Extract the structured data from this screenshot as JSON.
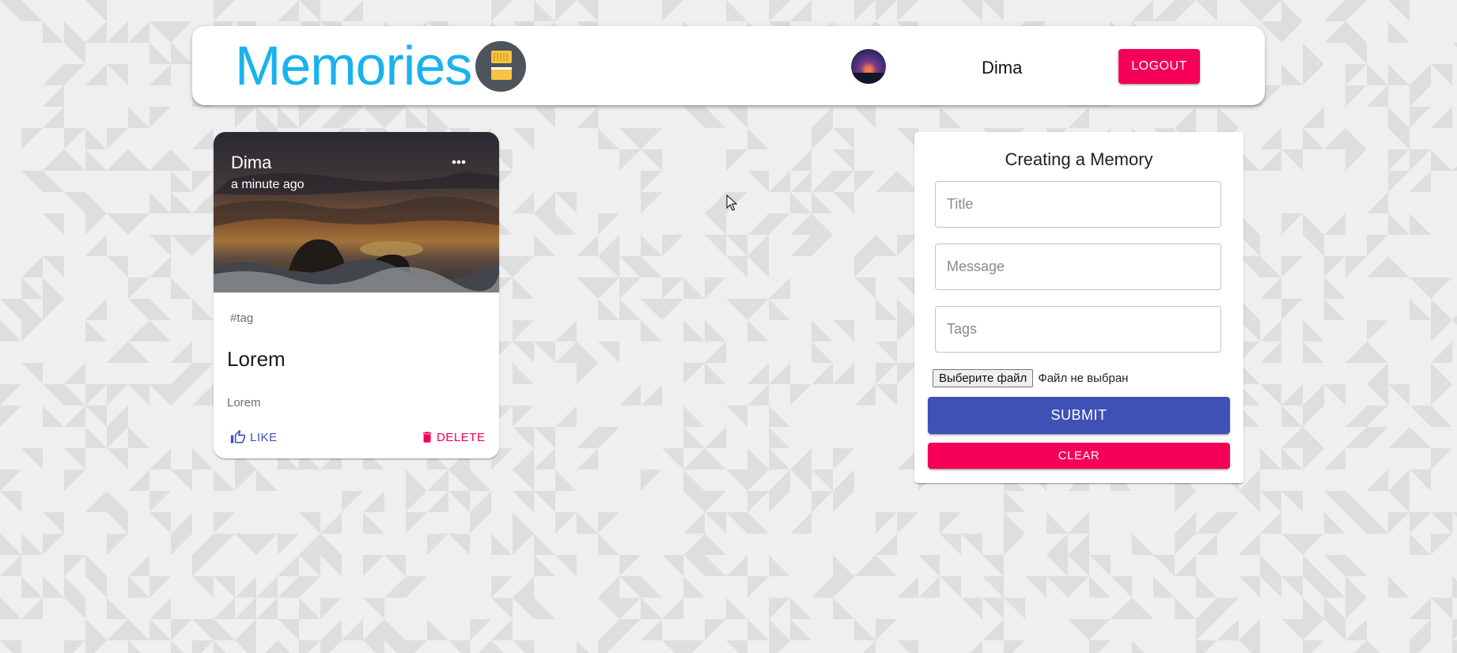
{
  "header": {
    "brand": "Memories",
    "brand_logo_icon": "memory-cards-icon",
    "user_name": "Dima",
    "logout_label": "LOGOUT"
  },
  "post": {
    "author": "Dima",
    "time": "a minute ago",
    "tags": "#tag",
    "title": "Lorem",
    "message": "Lorem",
    "like_label": "LIKE",
    "delete_label": "DELETE"
  },
  "form": {
    "title": "Creating a Memory",
    "title_placeholder": "Title",
    "message_placeholder": "Message",
    "tags_placeholder": "Tags",
    "file_button_label": "Выберите файл",
    "file_status": "Файл не выбран",
    "submit_label": "SUBMIT",
    "clear_label": "CLEAR"
  },
  "colors": {
    "brand": "#1ab2ef",
    "primary": "#3f51b5",
    "secondary": "#f50057",
    "background": "#efefef",
    "pattern": "#dedede"
  }
}
